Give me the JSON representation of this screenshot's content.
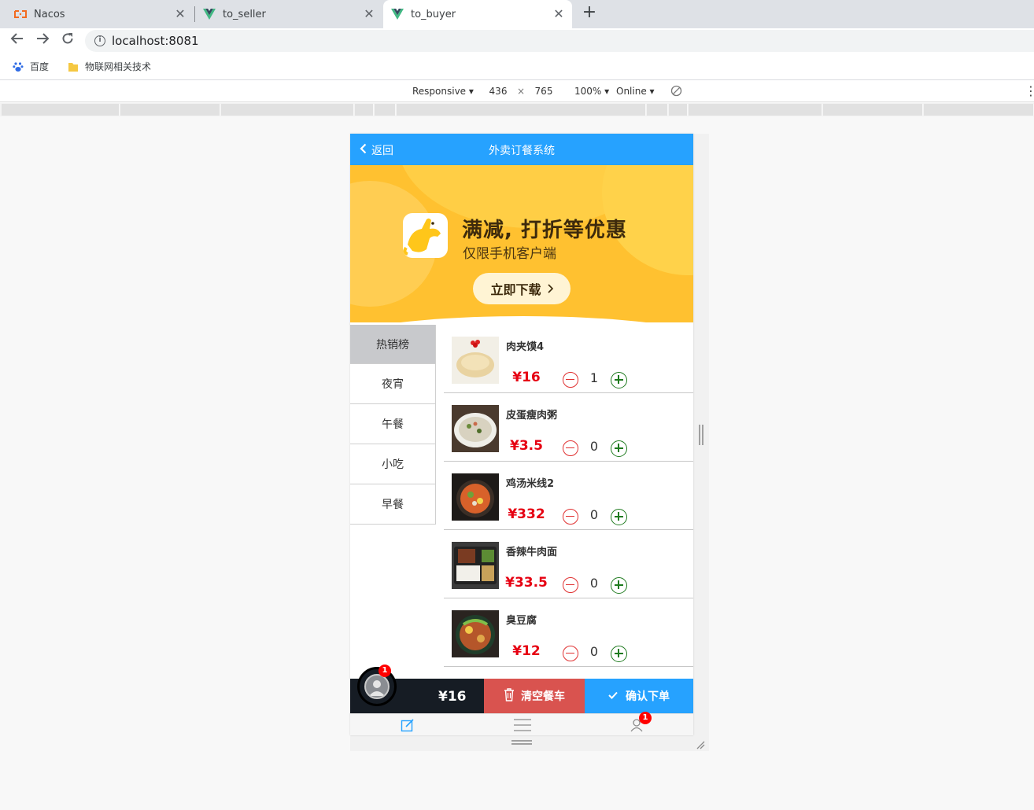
{
  "browser": {
    "tabs": [
      {
        "title": "Nacos",
        "icon": "nacos-icon",
        "active": false
      },
      {
        "title": "to_seller",
        "icon": "vue-icon",
        "active": false
      },
      {
        "title": "to_buyer",
        "icon": "vue-icon",
        "active": true
      }
    ],
    "url": "localhost:8081",
    "bookmarks": [
      {
        "label": "百度",
        "icon": "baidu-paw-icon"
      },
      {
        "label": "物联网相关技术",
        "icon": "folder-icon"
      }
    ]
  },
  "devtools": {
    "device": "Responsive ▾",
    "width": "436",
    "times": "×",
    "height": "765",
    "zoom": "100% ▾",
    "network": "Online ▾"
  },
  "app": {
    "back_label": "返回",
    "title": "外卖订餐系统",
    "banner": {
      "headline": "满减, 打折等优惠",
      "subline": "仅限手机客户端",
      "button": "立即下载"
    },
    "categories": [
      "热销榜",
      "夜宵",
      "午餐",
      "小吃",
      "早餐"
    ],
    "active_category": "热销榜",
    "foods": [
      {
        "name": "肉夹馍4",
        "price": "¥16",
        "qty": "1"
      },
      {
        "name": "皮蛋瘦肉粥",
        "price": "¥3.5",
        "qty": "0"
      },
      {
        "name": "鸡汤米线2",
        "price": "¥332",
        "qty": "0"
      },
      {
        "name": "香辣牛肉面",
        "price": "¥33.5",
        "qty": "0"
      },
      {
        "name": "臭豆腐",
        "price": "¥12",
        "qty": "0"
      }
    ],
    "cart": {
      "badge": "1",
      "total": "¥16",
      "clear_label": "清空餐车",
      "confirm_label": "确认下单"
    },
    "bottom_tabs": [
      {
        "icon": "edit-icon"
      },
      {
        "icon": "menu-icon"
      },
      {
        "icon": "user-icon",
        "badge": "1"
      }
    ],
    "colors": {
      "primary": "#26a2ff",
      "price": "#e60012",
      "clear": "#d9534f",
      "cart_bg": "#161c24",
      "banner": "#ffc130"
    }
  }
}
